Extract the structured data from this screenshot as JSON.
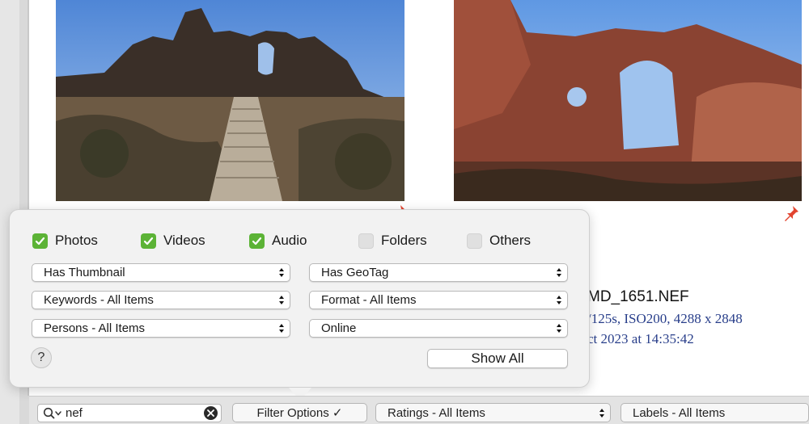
{
  "browser": {
    "file_name": "MD_1651.NEF",
    "exif": "/125s, ISO200, 4288 x 2848",
    "date": "ct 2023 at 14:35:42"
  },
  "filter": {
    "checkboxes": [
      {
        "label": "Photos",
        "checked": true
      },
      {
        "label": "Videos",
        "checked": true
      },
      {
        "label": "Audio",
        "checked": true
      },
      {
        "label": "Folders",
        "checked": false
      },
      {
        "label": "Others",
        "checked": false
      }
    ],
    "selects": {
      "thumbnail": "Has Thumbnail",
      "geotag": "Has GeoTag",
      "keywords": "Keywords - All Items",
      "format": "Format - All Items",
      "persons": "Persons - All Items",
      "online": "Online"
    },
    "help_label": "?",
    "show_all_label": "Show All"
  },
  "toolbar": {
    "search_value": "nef",
    "filter_options_label": "Filter Options ✓",
    "ratings_label": "Ratings - All Items",
    "labels_label": "Labels - All Items"
  },
  "colors": {
    "check_green": "#5cb336",
    "exif_blue": "#283e8a",
    "pin_red": "#e2442f"
  },
  "icons": [
    "checkmark-icon",
    "select-arrows-icon",
    "search-icon",
    "clear-icon",
    "pin-icon"
  ]
}
